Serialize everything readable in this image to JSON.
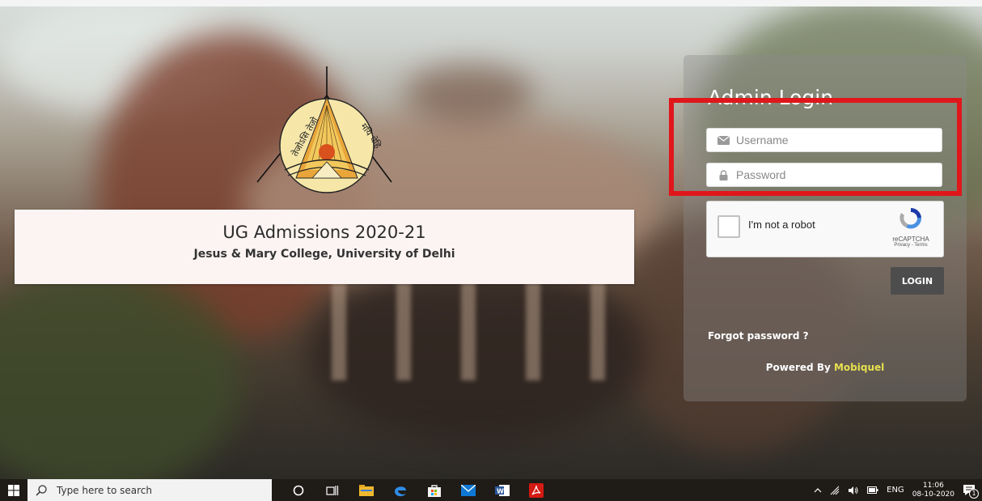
{
  "login": {
    "heading": "Admin Login",
    "username_placeholder": "Username",
    "password_placeholder": "Password",
    "login_label": "LOGIN",
    "forgot_label": "Forgot password ?",
    "powered_prefix": "Powered By",
    "powered_brand": "Mobiquel"
  },
  "captcha": {
    "label": "I'm not a robot",
    "brand": "reCAPTCHA",
    "links": "Privacy - Terms"
  },
  "banner": {
    "title": "UG Admissions 2020-21",
    "subtitle": "Jesus & Mary College, University of Delhi"
  },
  "logo": {
    "left_text": "तेजोऽसि तेजो",
    "right_text": "मयि धेहि"
  },
  "taskbar": {
    "search_placeholder": "Type here to search",
    "language": "ENG",
    "time": "11:06",
    "date": "08-10-2020",
    "notification_count": "1",
    "apps": [
      "cortana-icon",
      "task-view-icon",
      "file-explorer-icon",
      "edge-icon",
      "store-icon",
      "mail-icon",
      "word-icon",
      "acrobat-icon"
    ]
  },
  "colors": {
    "highlight": "#e0161b",
    "brand_accent": "#e6e04f",
    "button": "#4d4d4d"
  }
}
